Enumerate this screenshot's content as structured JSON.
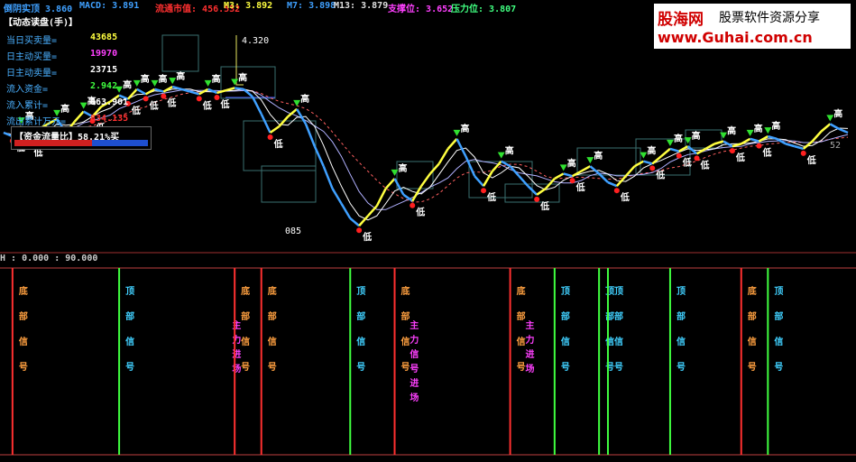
{
  "topbar": {
    "items": [
      {
        "label": "倒阴实顶",
        "value": "3.860",
        "color": "#3fa0ff"
      },
      {
        "label": "MACD:",
        "value": "3.891",
        "color": "#3fa0ff"
      },
      {
        "label": "流通市值:",
        "value": "456.532",
        "color": "#ff3030"
      },
      {
        "label": "M3:",
        "value": "3.892",
        "color": "#ffff40"
      },
      {
        "label": "M7:",
        "value": "3.898",
        "color": "#3fa0ff"
      },
      {
        "label": "M13:",
        "value": "3.879",
        "color": "#e0e0e0"
      },
      {
        "label": "支撑位:",
        "value": "3.652",
        "color": "#ff40ff"
      },
      {
        "label": "压力位:",
        "value": "3.807",
        "color": "#40ff80"
      }
    ]
  },
  "panel": {
    "title": "【动态读盘(手)】",
    "rows": [
      {
        "label": "当日买卖量=",
        "value": "43685",
        "color": "#ffff40"
      },
      {
        "label": "日主动买量=",
        "value": "19970",
        "color": "#ff40ff"
      },
      {
        "label": "日主动卖量=",
        "value": "23715",
        "color": "#ffffff"
      },
      {
        "label": "流入资金=",
        "value": "2.942",
        "color": "#40ff40"
      },
      {
        "label": "流入累计=",
        "value": "863.901",
        "color": "#ffffff"
      },
      {
        "label": "流出累计万元=",
        "value": "834.135",
        "color": "#ff3030"
      }
    ],
    "flow_label": "【资金流量比】58.21%买",
    "flow_buy_fraction": 0.5821
  },
  "logo": {
    "name": "股海网",
    "tag": "股票软件资源分享",
    "url": "www.Guhai.com.cn"
  },
  "sub_legend": "H : 0.000 : 90.000",
  "annotations": {
    "high_price": "4.320",
    "low_price": "085",
    "high_label": "高",
    "low_label": "低",
    "right_value": "52"
  },
  "chart_data": {
    "type": "line",
    "title": "",
    "price_series": [
      3.55,
      3.52,
      3.6,
      3.48,
      3.58,
      3.62,
      3.66,
      3.55,
      3.64,
      3.72,
      3.68,
      3.76,
      3.8,
      3.85,
      3.82,
      3.9,
      3.86,
      3.9,
      3.88,
      3.92,
      3.9,
      3.88,
      3.86,
      3.9,
      3.87,
      3.89,
      3.91,
      3.9,
      3.84,
      3.7,
      3.55,
      3.6,
      3.68,
      3.74,
      3.62,
      3.44,
      3.28,
      3.1,
      2.98,
      2.86,
      2.8,
      2.88,
      2.96,
      3.1,
      3.18,
      3.05,
      3.0,
      3.12,
      3.22,
      3.3,
      3.42,
      3.5,
      3.36,
      3.2,
      3.12,
      3.24,
      3.32,
      3.28,
      3.2,
      3.12,
      3.05,
      3.1,
      3.18,
      3.22,
      3.2,
      3.24,
      3.28,
      3.22,
      3.15,
      3.12,
      3.2,
      3.28,
      3.32,
      3.3,
      3.36,
      3.42,
      3.4,
      3.44,
      3.38,
      3.42,
      3.46,
      3.48,
      3.44,
      3.46,
      3.5,
      3.48,
      3.52,
      3.5,
      3.46,
      3.44,
      3.42,
      3.48,
      3.56,
      3.62,
      3.58,
      3.55
    ],
    "signals": [
      {
        "x": 1,
        "text": "底部信号",
        "type": "bottom",
        "color": "#ff3030"
      },
      {
        "x": 13,
        "text": "顶部信号",
        "type": "top",
        "color": "#40ff40"
      },
      {
        "x": 25,
        "text": "主力进场",
        "type": "entry",
        "color": "#ff40ff"
      },
      {
        "x": 26,
        "text": "底部信号",
        "type": "bottom",
        "color": "#ff3030"
      },
      {
        "x": 29,
        "text": "底部信号",
        "type": "bottom",
        "color": "#ff3030"
      },
      {
        "x": 39,
        "text": "顶部信号",
        "type": "top",
        "color": "#40ff40"
      },
      {
        "x": 44,
        "text": "底部信号",
        "type": "bottom",
        "color": "#ff3030"
      },
      {
        "x": 45,
        "text": "主力信号进场",
        "type": "entry",
        "color": "#ff40ff"
      },
      {
        "x": 57,
        "text": "底部信号",
        "type": "bottom",
        "color": "#ff3030"
      },
      {
        "x": 58,
        "text": "主力进场",
        "type": "entry",
        "color": "#ff40ff"
      },
      {
        "x": 62,
        "text": "顶部信号",
        "type": "top",
        "color": "#40ff40"
      },
      {
        "x": 67,
        "text": "顶部信号",
        "type": "top",
        "color": "#40ff40"
      },
      {
        "x": 68,
        "text": "顶部信号",
        "type": "top",
        "color": "#40ff40"
      },
      {
        "x": 75,
        "text": "顶部信号",
        "type": "top",
        "color": "#40ff40"
      },
      {
        "x": 83,
        "text": "底部信号",
        "type": "bottom",
        "color": "#ff3030"
      },
      {
        "x": 86,
        "text": "顶部信号",
        "type": "top",
        "color": "#40ff40"
      }
    ],
    "ylim": [
      2.7,
      4.4
    ]
  }
}
